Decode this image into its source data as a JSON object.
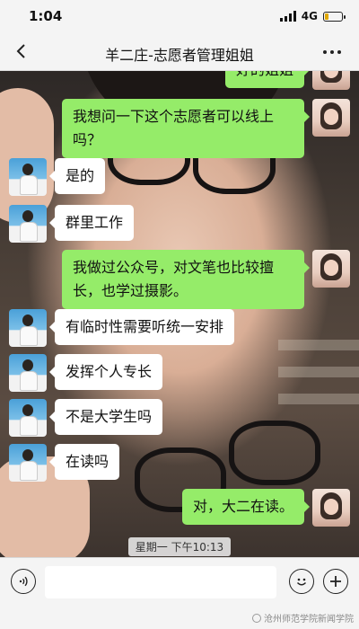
{
  "status_bar": {
    "time": "1:04",
    "network": "4G",
    "battery_color": "#e0a800"
  },
  "header": {
    "back_icon": "chevron-left-icon",
    "title": "羊二庄-志愿者管理姐姐",
    "more_icon": "more-dots-icon"
  },
  "messages": [
    {
      "side": "right",
      "text": "好的姐姐"
    },
    {
      "side": "right",
      "text": "我想问一下这个志愿者可以线上吗？"
    },
    {
      "side": "left",
      "text": "是的"
    },
    {
      "side": "left",
      "text": "群里工作"
    },
    {
      "side": "right",
      "text": "我做过公众号，对文笔也比较擅长，也学过摄影。"
    },
    {
      "side": "left",
      "text": "有临时性需要听统一安排"
    },
    {
      "side": "left",
      "text": "发挥个人专长"
    },
    {
      "side": "left",
      "text": "不是大学生吗"
    },
    {
      "side": "left",
      "text": "在读吗"
    },
    {
      "side": "right",
      "text": "对，大二在读。"
    }
  ],
  "timestamp": "星期一 下午10:13",
  "input_bar": {
    "voice_icon": "voice-icon",
    "input_value": "",
    "emoji_icon": "emoji-icon",
    "plus_icon": "plus-icon"
  },
  "watermark": "沧州师范学院新闻学院",
  "colors": {
    "self_bubble": "#95ec69",
    "other_bubble": "#ffffff",
    "bar_background": "#f4f4f4"
  }
}
